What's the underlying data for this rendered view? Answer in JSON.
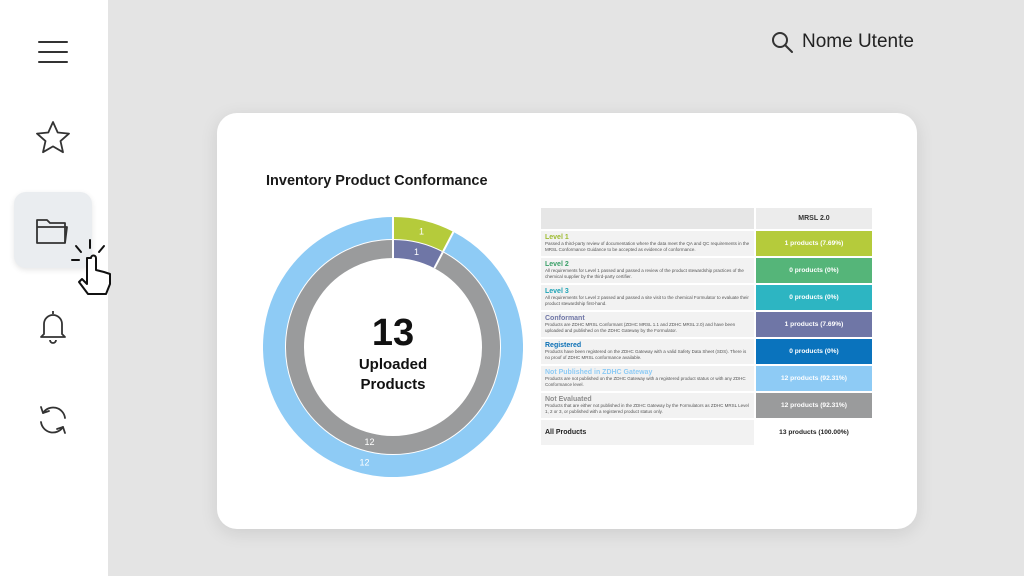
{
  "header": {
    "user_name": "Nome Utente"
  },
  "sidebar": {
    "items": [
      {
        "icon": "menu-icon"
      },
      {
        "icon": "star-icon"
      },
      {
        "icon": "folder-icon",
        "active": true
      },
      {
        "icon": "bell-icon"
      },
      {
        "icon": "refresh-icon"
      }
    ]
  },
  "card": {
    "title": "Inventory Product Conformance",
    "center_number": "13",
    "center_line1": "Uploaded",
    "center_line2": "Products"
  },
  "chart_data": {
    "type": "pie",
    "rings": [
      {
        "name": "outer",
        "slices": [
          {
            "label": "1",
            "value": 1,
            "color": "#b5cb3b"
          },
          {
            "label": "12",
            "value": 12,
            "color": "#8ecbf5"
          }
        ]
      },
      {
        "name": "inner",
        "slices": [
          {
            "label": "1",
            "value": 1,
            "color": "#6f76a6"
          },
          {
            "label": "12",
            "value": 12,
            "color": "#9a9b9c"
          }
        ]
      }
    ],
    "center_text": "13 Uploaded Products"
  },
  "table": {
    "column_header": "MRSL 2.0",
    "rows": [
      {
        "title": "Level 1",
        "title_color": "#9dbb2f",
        "desc": "Passed a third-party review of documentation where the data meet the QA and QC requirements in the MRSL Conformance Guidance to be accepted as evidence of conformance.",
        "value": "1 products (7.69%)",
        "color": "#b5cb3b"
      },
      {
        "title": "Level 2",
        "title_color": "#3aa068",
        "desc": "All requirements for Level 1 passed and passed a review of the product stewardship practices of the chemical supplier by the third-party certifier.",
        "value": "0 products (0%)",
        "color": "#55b579"
      },
      {
        "title": "Level 3",
        "title_color": "#1ea4b6",
        "desc": "All requirements for Level 2 passed and passed a site visit to the chemical Formulator to evaluate their product stewardship first-hand.",
        "value": "0 products (0%)",
        "color": "#2db5c2"
      },
      {
        "title": "Conformant",
        "title_color": "#6f76a6",
        "desc": "Products are ZDHC MRSL Conformant (ZDHC MRSL 1.1 and ZDHC MRSL 2.0) and have been uploaded and published on the ZDHC Gateway by the Formulator.",
        "value": "1 products (7.69%)",
        "color": "#6f76a6"
      },
      {
        "title": "Registered",
        "title_color": "#0a6fb5",
        "desc": "Products have been registered on the ZDHC Gateway with a valid Safety Data Sheet (SDS). There is no proof of ZDHC MRSL conformance available.",
        "value": "0 products (0%)",
        "color": "#0a73bd"
      },
      {
        "title": "Not Published in ZDHC Gateway",
        "title_color": "#8ecbf5",
        "desc": "Products are not published on the ZDHC Gateway with a registered product status or with any ZDHC Conformance level.",
        "value": "12 products (92.31%)",
        "color": "#8ecbf5"
      },
      {
        "title": "Not Evaluated",
        "title_color": "#8e8e8e",
        "desc": "Products that are either not published in the ZDHC Gateway by the Formulators as ZDHC MRSL Level 1, 2 or 3, or published with a registered product status only.",
        "value": "12 products (92.31%)",
        "color": "#9a9b9c"
      }
    ],
    "total_label": "All Products",
    "total_value": "13 products (100.00%)"
  }
}
